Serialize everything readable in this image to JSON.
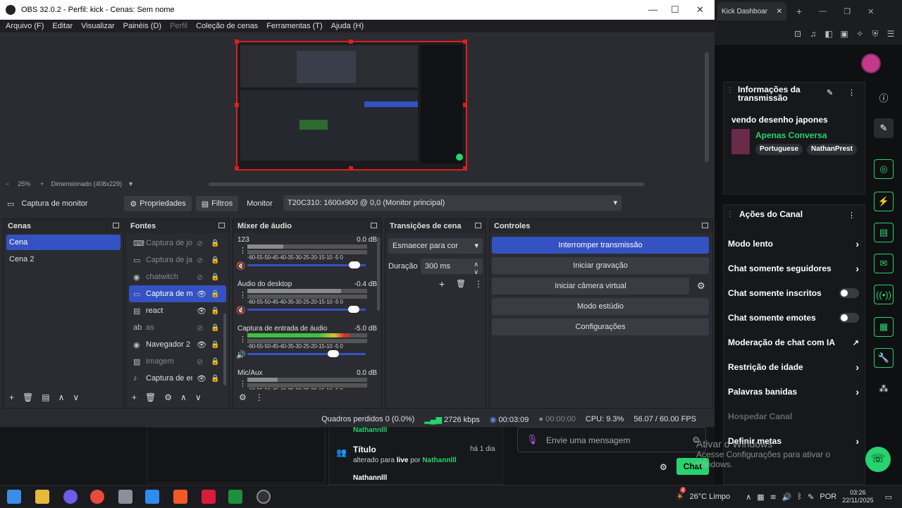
{
  "obs": {
    "title": "OBS 32.0.2 - Perfil: kick - Cenas: Sem nome",
    "menu": [
      "Arquivo (F)",
      "Editar",
      "Visualizar",
      "Painéis (D)",
      "Perfil",
      "Coleção de cenas",
      "Ferramentas (T)",
      "Ajuda (H)"
    ],
    "zoom": "25%",
    "zoom_plus": "+",
    "scaled": "Dimensionado (408x229)",
    "source_name": "Captura de monitor",
    "properties": "Propriedades",
    "filters": "Filtros",
    "monitor_label": "Monitor",
    "monitor_value": "T20C310: 1600x900 @ 0,0 (Monitor principal)",
    "docks": {
      "scenes": "Cenas",
      "sources": "Fontes",
      "mixer": "Mixer de áudio",
      "transitions": "Transições de cena",
      "controls": "Controles"
    },
    "scenes": [
      "Cena",
      "Cena 2"
    ],
    "sources": [
      {
        "icon": "gamepad-icon",
        "glyph": "⌨",
        "name": "Captura de jo",
        "visible": false
      },
      {
        "icon": "window-icon",
        "glyph": "▭",
        "name": "Captura de ja",
        "visible": false
      },
      {
        "icon": "globe-icon",
        "glyph": "◉",
        "name": "chatwitch",
        "visible": false
      },
      {
        "icon": "monitor-icon",
        "glyph": "▭",
        "name": "Captura de m",
        "visible": true
      },
      {
        "icon": "browser-icon",
        "glyph": "▤",
        "name": "react",
        "visible": true
      },
      {
        "icon": "text-icon",
        "glyph": "ab",
        "name": "as",
        "visible": false
      },
      {
        "icon": "globe-icon",
        "glyph": "◉",
        "name": "Navegador 2",
        "visible": true
      },
      {
        "icon": "image-icon",
        "glyph": "▨",
        "name": "Imagem",
        "visible": false
      },
      {
        "icon": "mic-icon",
        "glyph": "♪",
        "name": "Captura de er",
        "visible": true
      }
    ],
    "mixer": [
      {
        "name": "123",
        "db": "0.0 dB",
        "level": 0.3,
        "volume": 0.95,
        "muted": true
      },
      {
        "name": "Áudio do desktop",
        "db": "-0.4 dB",
        "level": 0.78,
        "volume": 0.94,
        "muted": true
      },
      {
        "name": "Captura de entrada de áudio",
        "db": "-5.0 dB",
        "level": 0.85,
        "volume": 0.75,
        "muted": false
      },
      {
        "name": "Mic/Aux",
        "db": "0.0 dB",
        "level": 0.25,
        "volume": 0.9,
        "muted": false
      }
    ],
    "meter_ticks": "-60-55-50-45-40-35-30-25-20-15-10 -5 0",
    "transition": "Esmaecer para cor",
    "duration_label": "Duração",
    "duration_value": "300 ms",
    "controls": [
      "Interromper transmissão",
      "Iniciar gravação",
      "Iniciar câmera virtual",
      "Modo estúdio",
      "Configurações"
    ],
    "status": {
      "dropped": "Quadros perdidos 0 (0.0%)",
      "bitrate": "2726 kbps",
      "stream_time": "00:03:09",
      "rec_time": "00:00:00",
      "cpu": "CPU: 9.3%",
      "fps": "56.07 / 60.00 FPS"
    }
  },
  "kick": {
    "tab": "Kick Dashboar",
    "stream_info_title": "Informações da transmissão",
    "stream_title": "vendo desenho japones",
    "category": "Apenas Conversa",
    "tags": [
      "Portuguese",
      "NathanPrest"
    ],
    "channel_actions_title": "Ações do Canal",
    "actions": [
      {
        "label": "Modo lento",
        "kind": "chev"
      },
      {
        "label": "Chat somente seguidores",
        "kind": "chev"
      },
      {
        "label": "Chat somente inscritos",
        "kind": "toggle"
      },
      {
        "label": "Chat somente emotes",
        "kind": "toggle"
      },
      {
        "label": "Moderação de chat com IA",
        "kind": "ext"
      },
      {
        "label": "Restrição de idade",
        "kind": "chev"
      },
      {
        "label": "Palavras banidas",
        "kind": "chev"
      },
      {
        "label": "Hospedar Canal",
        "kind": "dim"
      },
      {
        "label": "Definir metas",
        "kind": "chev"
      }
    ],
    "activity_user_top": "Nathannlll",
    "activity_title": "Título",
    "activity_time": "há 1 dia",
    "activity_text_pre": "alterado para",
    "activity_value": "live",
    "activity_by": "por",
    "activity_user": "Nathannlll",
    "activity_user_cut": "Nathannlll",
    "chat_placeholder": "Envie uma mensagem",
    "chat_button": "Chat",
    "win_activate": "Ativar o Windows",
    "win_activate_sub": "Acesse Configurações para ativar o Windows."
  },
  "taskbar": {
    "weather": "26°C Limpo",
    "lang": "POR",
    "time": "03:26",
    "date": "22/11/2025",
    "badge": "4"
  },
  "colors": {
    "accent": "#3552c2",
    "kick_green": "#27d36e",
    "selection_red": "#e01e1e"
  }
}
